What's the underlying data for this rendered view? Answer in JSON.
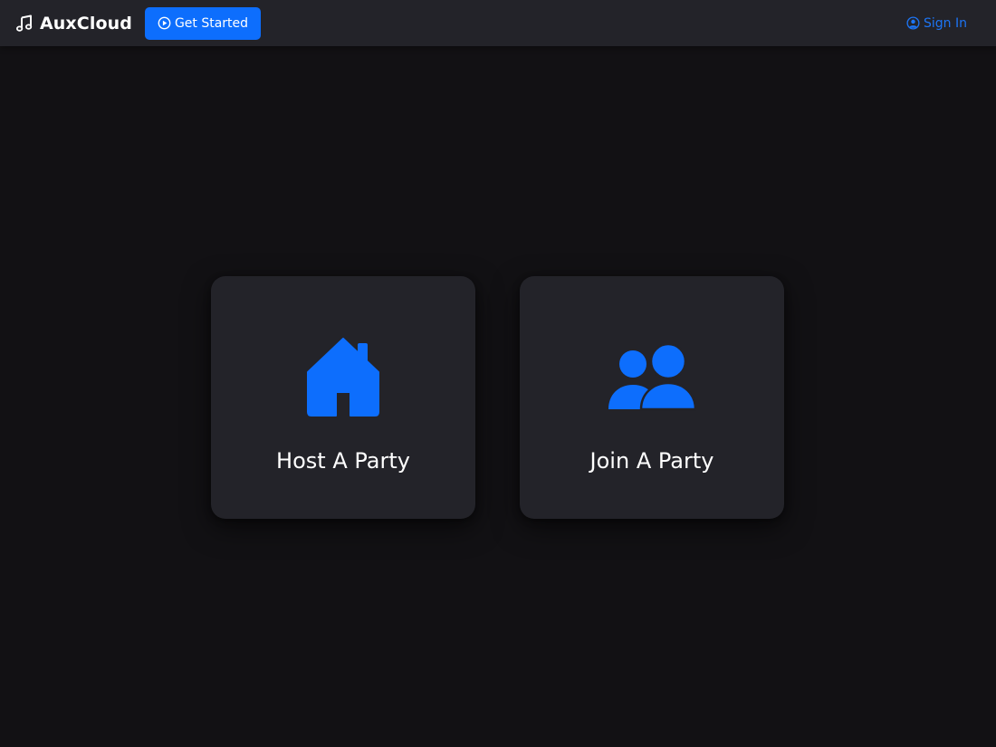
{
  "navbar": {
    "brand_icon": "music-note-icon",
    "brand_name": "AuxCloud",
    "get_started_icon": "play-circle-icon",
    "get_started_label": "Get Started",
    "sign_in_icon": "user-circle-icon",
    "sign_in_label": "Sign In"
  },
  "cards": {
    "host": {
      "icon": "house-icon",
      "label": "Host A Party"
    },
    "join": {
      "icon": "people-icon",
      "label": "Join A Party"
    }
  },
  "colors": {
    "background": "#121114",
    "surface": "#232329",
    "accent": "#0d6efd",
    "accent_text": "#1d75f5",
    "text": "#ffffff"
  }
}
